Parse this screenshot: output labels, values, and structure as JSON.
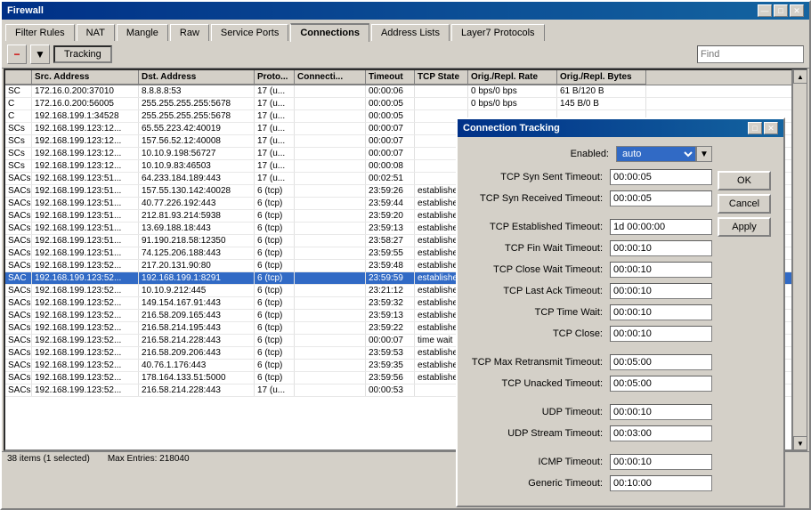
{
  "window": {
    "title": "Firewall"
  },
  "tabs": [
    {
      "label": "Filter Rules",
      "active": false
    },
    {
      "label": "NAT",
      "active": false
    },
    {
      "label": "Mangle",
      "active": false
    },
    {
      "label": "Raw",
      "active": false
    },
    {
      "label": "Service Ports",
      "active": false
    },
    {
      "label": "Connections",
      "active": true
    },
    {
      "label": "Address Lists",
      "active": false
    },
    {
      "label": "Layer7 Protocols",
      "active": false
    }
  ],
  "toolbar": {
    "tracking_label": "Tracking",
    "find_placeholder": "Find"
  },
  "table": {
    "columns": [
      "",
      "Src. Address",
      "Dst. Address",
      "Proto...",
      "Connecti...",
      "Timeout",
      "TCP State",
      "Orig./Repl. Rate",
      "Orig./Repl. Bytes"
    ],
    "rows": [
      {
        "flags": "SC",
        "src": "172.16.0.200:37010",
        "dst": "8.8.8.8:53",
        "proto": "17 (u...",
        "conn": "",
        "timeout": "00:00:06",
        "state": "",
        "rate": "0 bps/0 bps",
        "bytes": "61 B/120 B"
      },
      {
        "flags": "C",
        "src": "172.16.0.200:56005",
        "dst": "255.255.255.255:5678",
        "proto": "17 (u...",
        "conn": "",
        "timeout": "00:00:05",
        "state": "",
        "rate": "0 bps/0 bps",
        "bytes": "145 B/0 B"
      },
      {
        "flags": "C",
        "src": "192.168.199.1:34528",
        "dst": "255.255.255.255:5678",
        "proto": "17 (u...",
        "conn": "",
        "timeout": "00:00:05",
        "state": "",
        "rate": "",
        "bytes": ""
      },
      {
        "flags": "SCs",
        "src": "192.168.199.123:12...",
        "dst": "65.55.223.42:40019",
        "proto": "17 (u...",
        "conn": "",
        "timeout": "00:00:07",
        "state": "",
        "rate": "",
        "bytes": ""
      },
      {
        "flags": "SCs",
        "src": "192.168.199.123:12...",
        "dst": "157.56.52.12:40008",
        "proto": "17 (u...",
        "conn": "",
        "timeout": "00:00:07",
        "state": "",
        "rate": "",
        "bytes": ""
      },
      {
        "flags": "SCs",
        "src": "192.168.199.123:12...",
        "dst": "10.10.9.198:56727",
        "proto": "17 (u...",
        "conn": "",
        "timeout": "00:00:07",
        "state": "",
        "rate": "",
        "bytes": ""
      },
      {
        "flags": "SCs",
        "src": "192.168.199.123:12...",
        "dst": "10.10.9.83:46503",
        "proto": "17 (u...",
        "conn": "",
        "timeout": "00:00:08",
        "state": "",
        "rate": "",
        "bytes": ""
      },
      {
        "flags": "SACs",
        "src": "192.168.199.123:51...",
        "dst": "64.233.184.189:443",
        "proto": "17 (u...",
        "conn": "",
        "timeout": "00:02:51",
        "state": "",
        "rate": "",
        "bytes": ""
      },
      {
        "flags": "SACs",
        "src": "192.168.199.123:51...",
        "dst": "157.55.130.142:40028",
        "proto": "6 (tcp)",
        "conn": "",
        "timeout": "23:59:26",
        "state": "established",
        "rate": "",
        "bytes": ""
      },
      {
        "flags": "SACs",
        "src": "192.168.199.123:51...",
        "dst": "40.77.226.192:443",
        "proto": "6 (tcp)",
        "conn": "",
        "timeout": "23:59:44",
        "state": "established",
        "rate": "",
        "bytes": ""
      },
      {
        "flags": "SACs",
        "src": "192.168.199.123:51...",
        "dst": "212.81.93.214:5938",
        "proto": "6 (tcp)",
        "conn": "",
        "timeout": "23:59:20",
        "state": "established",
        "rate": "",
        "bytes": ""
      },
      {
        "flags": "SACs",
        "src": "192.168.199.123:51...",
        "dst": "13.69.188.18:443",
        "proto": "6 (tcp)",
        "conn": "",
        "timeout": "23:59:13",
        "state": "established",
        "rate": "",
        "bytes": ""
      },
      {
        "flags": "SACs",
        "src": "192.168.199.123:51...",
        "dst": "91.190.218.58:12350",
        "proto": "6 (tcp)",
        "conn": "",
        "timeout": "23:58:27",
        "state": "established",
        "rate": "",
        "bytes": ""
      },
      {
        "flags": "SACs",
        "src": "192.168.199.123:51...",
        "dst": "74.125.206.188:443",
        "proto": "6 (tcp)",
        "conn": "",
        "timeout": "23:59:55",
        "state": "established",
        "rate": "",
        "bytes": ""
      },
      {
        "flags": "SACs",
        "src": "192.168.199.123:52...",
        "dst": "217.20.131.90:80",
        "proto": "6 (tcp)",
        "conn": "",
        "timeout": "23:59:48",
        "state": "established",
        "rate": "",
        "bytes": ""
      },
      {
        "flags": "SAC",
        "src": "192.168.199.123:52...",
        "dst": "192.168.199.1:8291",
        "proto": "6 (tcp)",
        "conn": "",
        "timeout": "23:59:59",
        "state": "established",
        "rate": "",
        "bytes": "",
        "selected": true
      },
      {
        "flags": "SACs",
        "src": "192.168.199.123:52...",
        "dst": "10.10.9.212:445",
        "proto": "6 (tcp)",
        "conn": "",
        "timeout": "23:21:12",
        "state": "established",
        "rate": "",
        "bytes": ""
      },
      {
        "flags": "SACs",
        "src": "192.168.199.123:52...",
        "dst": "149.154.167.91:443",
        "proto": "6 (tcp)",
        "conn": "",
        "timeout": "23:59:32",
        "state": "established",
        "rate": "",
        "bytes": ""
      },
      {
        "flags": "SACs",
        "src": "192.168.199.123:52...",
        "dst": "216.58.209.165:443",
        "proto": "6 (tcp)",
        "conn": "",
        "timeout": "23:59:13",
        "state": "established",
        "rate": "",
        "bytes": ""
      },
      {
        "flags": "SACs",
        "src": "192.168.199.123:52...",
        "dst": "216.58.214.195:443",
        "proto": "6 (tcp)",
        "conn": "",
        "timeout": "23:59:22",
        "state": "established",
        "rate": "",
        "bytes": ""
      },
      {
        "flags": "SACs",
        "src": "192.168.199.123:52...",
        "dst": "216.58.214.228:443",
        "proto": "6 (tcp)",
        "conn": "",
        "timeout": "00:00:07",
        "state": "time wait",
        "rate": "",
        "bytes": ""
      },
      {
        "flags": "SACs",
        "src": "192.168.199.123:52...",
        "dst": "216.58.209.206:443",
        "proto": "6 (tcp)",
        "conn": "",
        "timeout": "23:59:53",
        "state": "established",
        "rate": "",
        "bytes": ""
      },
      {
        "flags": "SACs",
        "src": "192.168.199.123:52...",
        "dst": "40.76.1.176:443",
        "proto": "6 (tcp)",
        "conn": "",
        "timeout": "23:59:35",
        "state": "established",
        "rate": "",
        "bytes": ""
      },
      {
        "flags": "SACs",
        "src": "192.168.199.123:52...",
        "dst": "178.164.133.51:5000",
        "proto": "6 (tcp)",
        "conn": "",
        "timeout": "23:59:56",
        "state": "established",
        "rate": "",
        "bytes": ""
      },
      {
        "flags": "SACs",
        "src": "192.168.199.123:52...",
        "dst": "216.58.214.228:443",
        "proto": "17 (u...",
        "conn": "",
        "timeout": "00:00:53",
        "state": "",
        "rate": "",
        "bytes": ""
      }
    ]
  },
  "status_bar": {
    "items": "38 items (1 selected)",
    "max_entries": "Max Entries: 218040"
  },
  "dialog": {
    "title": "Connection Tracking",
    "enabled_label": "Enabled:",
    "enabled_value": "auto",
    "buttons": {
      "ok": "OK",
      "cancel": "Cancel",
      "apply": "Apply"
    },
    "fields": [
      {
        "label": "TCP Syn Sent Timeout:",
        "value": "00:00:05"
      },
      {
        "label": "TCP Syn Received Timeout:",
        "value": "00:00:05"
      },
      {
        "label": "TCP Established Timeout:",
        "value": "1d 00:00:00"
      },
      {
        "label": "TCP Fin Wait Timeout:",
        "value": "00:00:10"
      },
      {
        "label": "TCP Close Wait Timeout:",
        "value": "00:00:10"
      },
      {
        "label": "TCP Last Ack Timeout:",
        "value": "00:00:10"
      },
      {
        "label": "TCP Time Wait:",
        "value": "00:00:10"
      },
      {
        "label": "TCP Close:",
        "value": "00:00:10"
      },
      {
        "label": "TCP Max Retransmit Timeout:",
        "value": "00:05:00"
      },
      {
        "label": "TCP Unacked Timeout:",
        "value": "00:05:00"
      },
      {
        "label": "UDP Timeout:",
        "value": "00:00:10"
      },
      {
        "label": "UDP Stream Timeout:",
        "value": "00:03:00"
      },
      {
        "label": "ICMP Timeout:",
        "value": "00:00:10"
      },
      {
        "label": "Generic Timeout:",
        "value": "00:10:00"
      }
    ]
  }
}
